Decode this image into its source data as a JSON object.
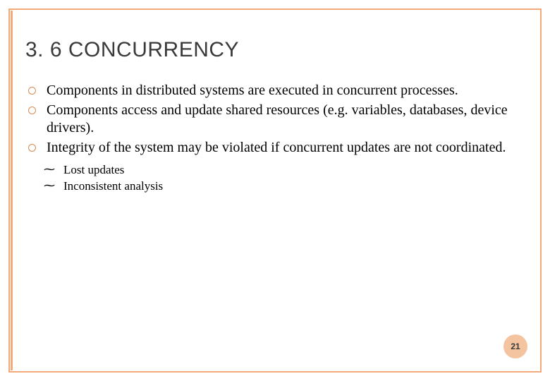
{
  "slide": {
    "title": "3. 6 CONCURRENCY",
    "bullets": [
      "Components in distributed systems are executed in concurrent processes.",
      "Components access and update shared resources (e.g. variables, databases, device drivers).",
      "Integrity of the system may be violated if concurrent updates are not coordinated."
    ],
    "sub_bullets": [
      "Lost updates",
      "Inconsistent analysis"
    ],
    "page_number": "21"
  }
}
